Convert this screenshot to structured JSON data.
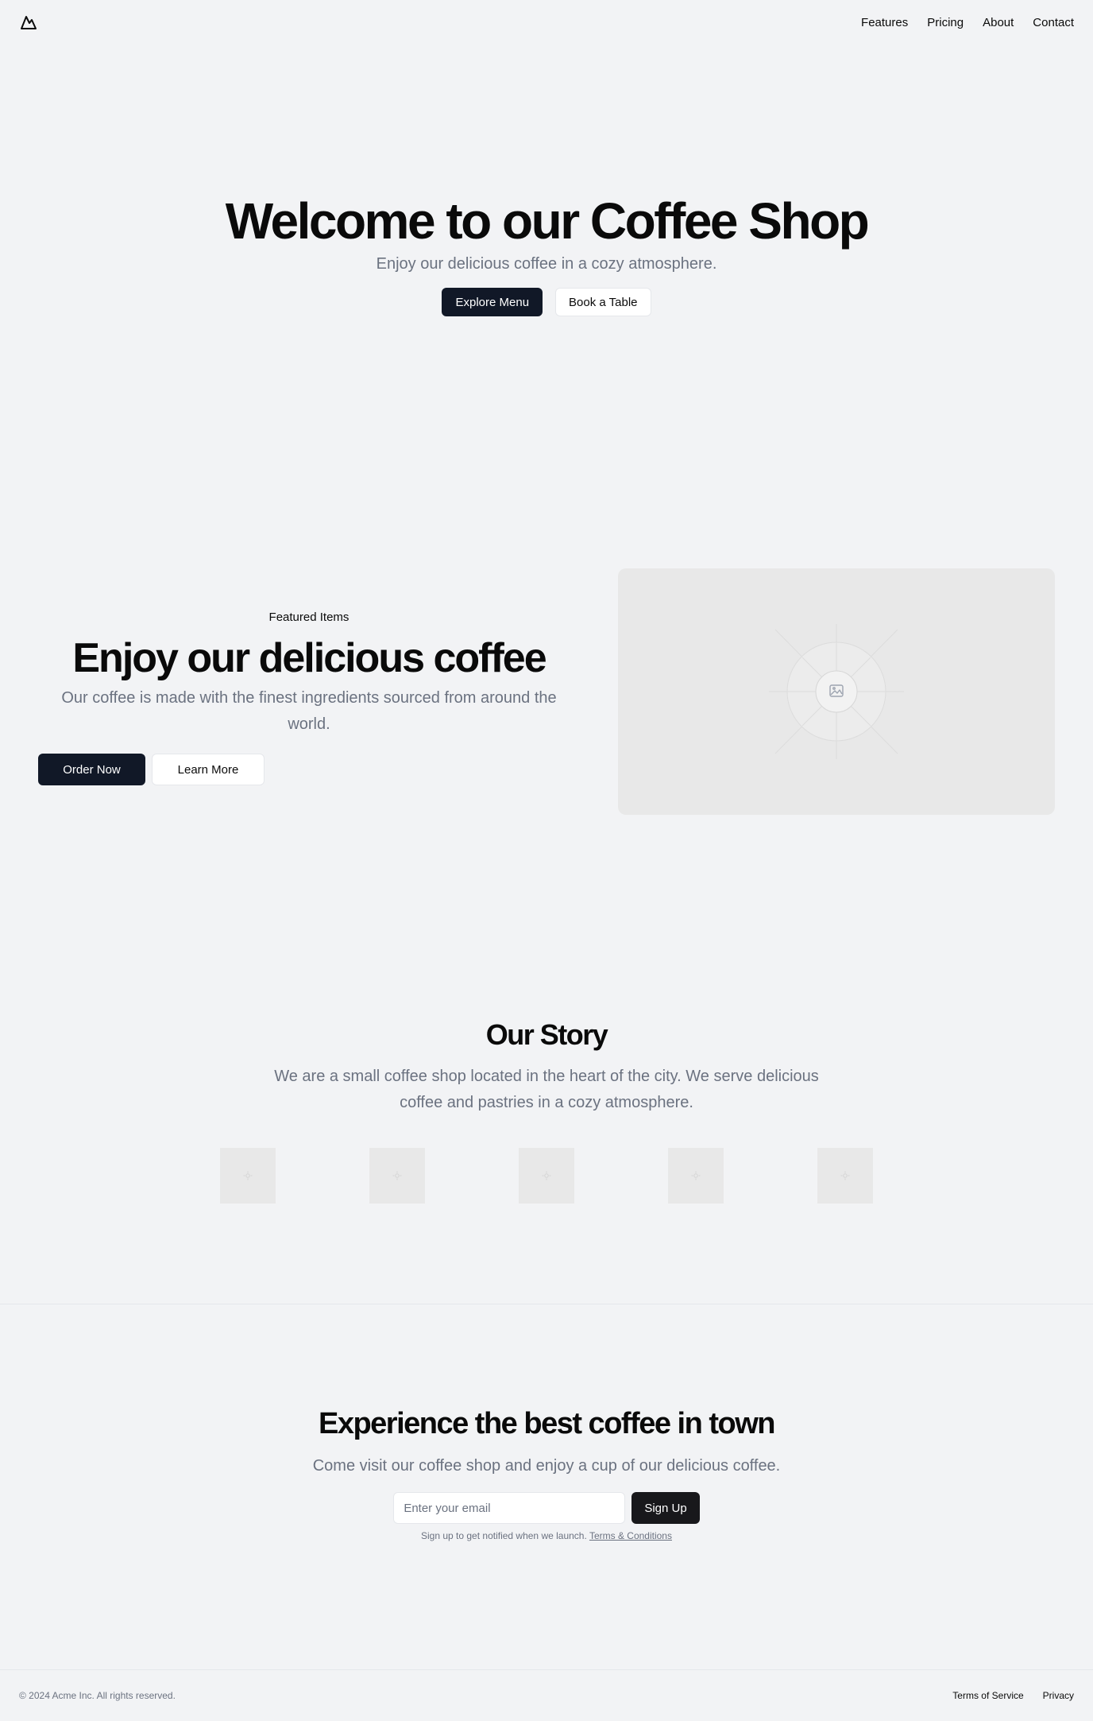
{
  "header": {
    "logo_icon": "mountain-icon",
    "nav": [
      {
        "label": "Features"
      },
      {
        "label": "Pricing"
      },
      {
        "label": "About"
      },
      {
        "label": "Contact"
      }
    ]
  },
  "hero": {
    "title": "Welcome to our Coffee Shop",
    "subtitle": "Enjoy our delicious coffee in a cozy atmosphere.",
    "primary_button": "Explore Menu",
    "secondary_button": "Book a Table"
  },
  "featured": {
    "eyebrow": "Featured Items",
    "title": "Enjoy our delicious coffee",
    "description": "Our coffee is made with the finest ingredients sourced from around the world.",
    "primary_button": "Order Now",
    "secondary_button": "Learn More",
    "image_icon": "image-placeholder-icon"
  },
  "story": {
    "title": "Our Story",
    "description": "We are a small coffee shop located in the heart of the city. We serve delicious coffee and pastries in a cozy atmosphere.",
    "thumbnail_count": 5
  },
  "cta": {
    "title": "Experience the best coffee in town",
    "description": "Come visit our coffee shop and enjoy a cup of our delicious coffee.",
    "email_placeholder": "Enter your email",
    "button": "Sign Up",
    "fine_print": "Sign up to get notified when we launch.",
    "terms_link": "Terms & Conditions"
  },
  "footer": {
    "copyright": "© 2024 Acme Inc. All rights reserved.",
    "links": [
      {
        "label": "Terms of Service"
      },
      {
        "label": "Privacy"
      }
    ]
  },
  "colors": {
    "background": "#f2f3f5",
    "primary_button": "#111827",
    "muted_text": "#6b7280",
    "placeholder": "#e8e8e8"
  }
}
